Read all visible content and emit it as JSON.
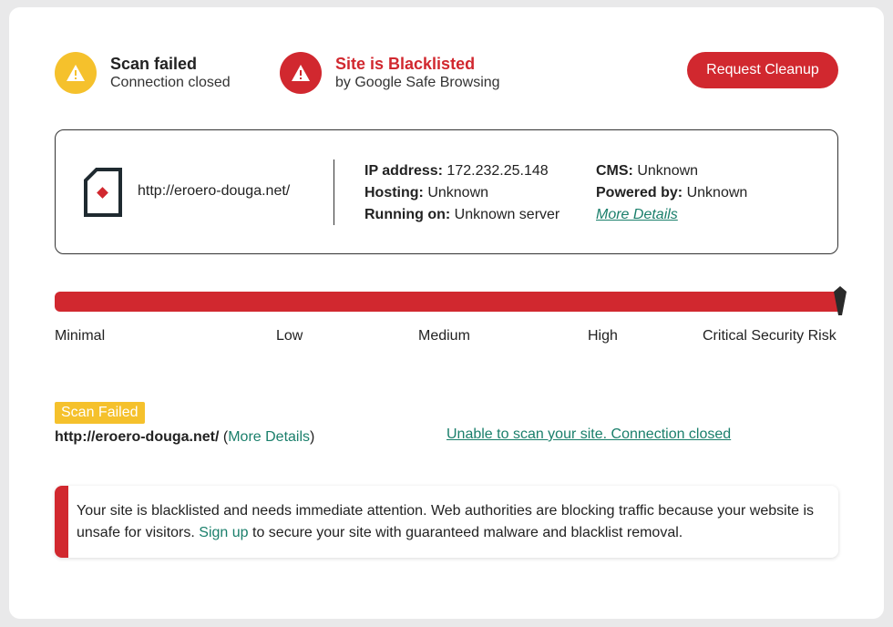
{
  "status_scan": {
    "title": "Scan failed",
    "subtitle": "Connection closed",
    "icon": "warning-icon",
    "color": "#f5c12c"
  },
  "status_blacklist": {
    "title": "Site is Blacklisted",
    "subtitle": "by Google Safe Browsing",
    "icon": "warning-icon",
    "color": "#d1282f"
  },
  "cleanup_button": "Request Cleanup",
  "site": {
    "url": "http://eroero-douga.net/",
    "ip_label": "IP address:",
    "ip_value": "172.232.25.148",
    "hosting_label": "Hosting:",
    "hosting_value": "Unknown",
    "running_label": "Running on:",
    "running_value": "Unknown server",
    "cms_label": "CMS:",
    "cms_value": "Unknown",
    "powered_label": "Powered by:",
    "powered_value": "Unknown",
    "more_details": "More Details"
  },
  "risk": {
    "levels": [
      "Minimal",
      "Low",
      "Medium",
      "High",
      "Critical Security Risk"
    ],
    "current": "Critical Security Risk",
    "fill_fraction": 1.0
  },
  "scan_result": {
    "badge": "Scan Failed",
    "url": "http://eroero-douga.net/",
    "open_paren": "(",
    "more_details": "More Details",
    "close_paren": ")",
    "message": "Unable to scan your site. Connection closed"
  },
  "alert": {
    "text_before": "Your site is blacklisted and needs immediate attention. Web authorities are blocking traffic because your website is unsafe for visitors.",
    "link": "Sign up",
    "text_after": "to secure your site with guaranteed malware and blacklist removal."
  },
  "colors": {
    "accent_red": "#d1282f",
    "warning_yellow": "#f5c12c",
    "link_teal": "#1a7f6b"
  }
}
